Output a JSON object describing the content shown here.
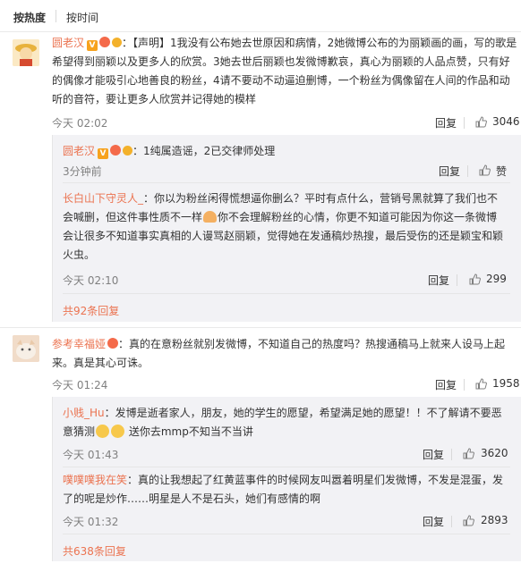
{
  "sort": {
    "hot": "按热度",
    "time": "按时间"
  },
  "c1": {
    "name": "圆老汉",
    "lines": [
      "：【声明】1我没有公布她去世原因和病情，2她微博公布的为丽颖画的画，写的歌是",
      "希望得到丽颖以及更多人的欣赏。3她去世后丽颖也发微博歉哀，真心为丽颖的人品点赞，只有好",
      "的偶像才能吸引心地善良的粉丝，4请不要动不动逼迫删博，一个粉丝为偶像留在人间的作品和动",
      "听的音符，要让更多人欣赏并记得她的模样"
    ],
    "time": "今天 02:02",
    "reply": "回复",
    "likes": "3046",
    "replies": [
      {
        "name": "圆老汉",
        "text": "：1纯属造谣，2已交律师处理",
        "time": "3分钟前",
        "reply": "回复",
        "likes": "赞"
      },
      {
        "name": "长白山下守灵人_",
        "lines": [
          "：你以为粉丝闲得慌想逼你删么？平时有点什么，营销号黑就算了我们也不",
          "会喊删，但这件事性质不一样",
          "你不会理解粉丝的心情，你更不知道可能因为你这一条微博",
          "会让很多不知道事实真相的人谩骂赵丽颖，觉得她在发通稿炒热搜，最后受伤的还是颖宝和颖",
          "火虫。"
        ],
        "time": "今天 02:10",
        "reply": "回复",
        "likes": "299"
      }
    ],
    "more": "共92条回复"
  },
  "c2": {
    "name": "参考幸福娅",
    "lines": [
      "：真的在意粉丝就别发微博，不知道自己的热度吗？热搜通稿马上就来人设马上起",
      "来。真是其心可诛。"
    ],
    "time": "今天 01:24",
    "reply": "回复",
    "likes": "1958",
    "replies": [
      {
        "name": "小贱_Hu",
        "lines": [
          "：发博是逝者家人，朋友，她的学生的愿望，希望满足她的愿望！！不了解请不要恶",
          "意猜测",
          "   送你去mmp不知当不当讲"
        ],
        "time": "今天 01:43",
        "reply": "回复",
        "likes": "3620"
      },
      {
        "name": "噗噗噗我在笑",
        "lines": [
          "：真的让我想起了红黄蓝事件的时候网友叫嚣着明星们发微博，不发是混蛋，发",
          "了的呢是炒作……明星是人不是石头，她们有感情的啊"
        ],
        "time": "今天 01:32",
        "reply": "回复",
        "likes": "2893"
      }
    ],
    "more": "共638条回复"
  }
}
